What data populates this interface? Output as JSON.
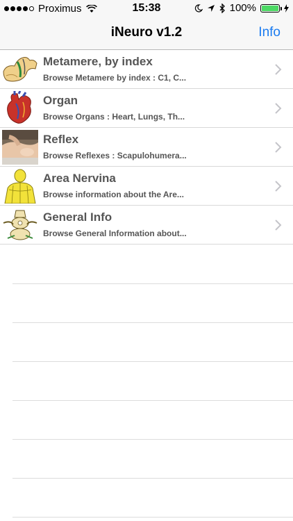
{
  "status_bar": {
    "carrier": "Proximus",
    "time": "15:38",
    "battery": "100%",
    "battery_level": 1.0,
    "signal_bars": 4
  },
  "nav": {
    "title": "iNeuro v1.2",
    "info_label": "Info"
  },
  "rows": [
    {
      "title": "Metamere, by index",
      "subtitle": "Browse Metamere by index : C1, C...",
      "icon": "spine-segment-icon"
    },
    {
      "title": "Organ",
      "subtitle": "Browse Organs : Heart, Lungs, Th...",
      "icon": "heart-icon"
    },
    {
      "title": "Reflex",
      "subtitle": "Browse Reflexes : Scapulohumera...",
      "icon": "reflex-photo-icon"
    },
    {
      "title": "Area Nervina",
      "subtitle": "Browse information about the Are...",
      "icon": "body-area-icon"
    },
    {
      "title": "General Info",
      "subtitle": "Browse General Information about...",
      "icon": "vertebra-icon"
    }
  ],
  "colors": {
    "accent": "#1a7bf0",
    "text": "#555555",
    "separator": "#d8d8d8"
  }
}
